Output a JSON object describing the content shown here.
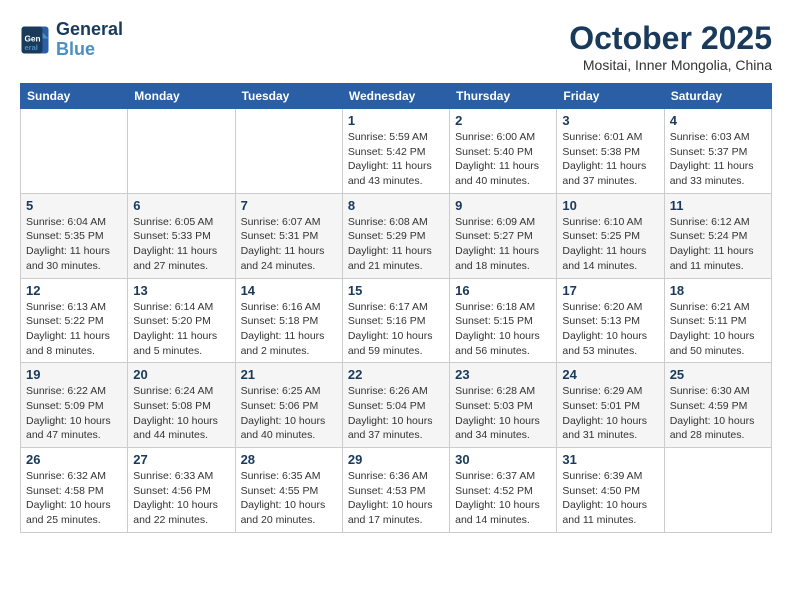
{
  "logo": {
    "line1": "General",
    "line2": "Blue"
  },
  "title": "October 2025",
  "location": "Mositai, Inner Mongolia, China",
  "days_header": [
    "Sunday",
    "Monday",
    "Tuesday",
    "Wednesday",
    "Thursday",
    "Friday",
    "Saturday"
  ],
  "weeks": [
    [
      {
        "day": "",
        "info": ""
      },
      {
        "day": "",
        "info": ""
      },
      {
        "day": "",
        "info": ""
      },
      {
        "day": "1",
        "info": "Sunrise: 5:59 AM\nSunset: 5:42 PM\nDaylight: 11 hours\nand 43 minutes."
      },
      {
        "day": "2",
        "info": "Sunrise: 6:00 AM\nSunset: 5:40 PM\nDaylight: 11 hours\nand 40 minutes."
      },
      {
        "day": "3",
        "info": "Sunrise: 6:01 AM\nSunset: 5:38 PM\nDaylight: 11 hours\nand 37 minutes."
      },
      {
        "day": "4",
        "info": "Sunrise: 6:03 AM\nSunset: 5:37 PM\nDaylight: 11 hours\nand 33 minutes."
      }
    ],
    [
      {
        "day": "5",
        "info": "Sunrise: 6:04 AM\nSunset: 5:35 PM\nDaylight: 11 hours\nand 30 minutes."
      },
      {
        "day": "6",
        "info": "Sunrise: 6:05 AM\nSunset: 5:33 PM\nDaylight: 11 hours\nand 27 minutes."
      },
      {
        "day": "7",
        "info": "Sunrise: 6:07 AM\nSunset: 5:31 PM\nDaylight: 11 hours\nand 24 minutes."
      },
      {
        "day": "8",
        "info": "Sunrise: 6:08 AM\nSunset: 5:29 PM\nDaylight: 11 hours\nand 21 minutes."
      },
      {
        "day": "9",
        "info": "Sunrise: 6:09 AM\nSunset: 5:27 PM\nDaylight: 11 hours\nand 18 minutes."
      },
      {
        "day": "10",
        "info": "Sunrise: 6:10 AM\nSunset: 5:25 PM\nDaylight: 11 hours\nand 14 minutes."
      },
      {
        "day": "11",
        "info": "Sunrise: 6:12 AM\nSunset: 5:24 PM\nDaylight: 11 hours\nand 11 minutes."
      }
    ],
    [
      {
        "day": "12",
        "info": "Sunrise: 6:13 AM\nSunset: 5:22 PM\nDaylight: 11 hours\nand 8 minutes."
      },
      {
        "day": "13",
        "info": "Sunrise: 6:14 AM\nSunset: 5:20 PM\nDaylight: 11 hours\nand 5 minutes."
      },
      {
        "day": "14",
        "info": "Sunrise: 6:16 AM\nSunset: 5:18 PM\nDaylight: 11 hours\nand 2 minutes."
      },
      {
        "day": "15",
        "info": "Sunrise: 6:17 AM\nSunset: 5:16 PM\nDaylight: 10 hours\nand 59 minutes."
      },
      {
        "day": "16",
        "info": "Sunrise: 6:18 AM\nSunset: 5:15 PM\nDaylight: 10 hours\nand 56 minutes."
      },
      {
        "day": "17",
        "info": "Sunrise: 6:20 AM\nSunset: 5:13 PM\nDaylight: 10 hours\nand 53 minutes."
      },
      {
        "day": "18",
        "info": "Sunrise: 6:21 AM\nSunset: 5:11 PM\nDaylight: 10 hours\nand 50 minutes."
      }
    ],
    [
      {
        "day": "19",
        "info": "Sunrise: 6:22 AM\nSunset: 5:09 PM\nDaylight: 10 hours\nand 47 minutes."
      },
      {
        "day": "20",
        "info": "Sunrise: 6:24 AM\nSunset: 5:08 PM\nDaylight: 10 hours\nand 44 minutes."
      },
      {
        "day": "21",
        "info": "Sunrise: 6:25 AM\nSunset: 5:06 PM\nDaylight: 10 hours\nand 40 minutes."
      },
      {
        "day": "22",
        "info": "Sunrise: 6:26 AM\nSunset: 5:04 PM\nDaylight: 10 hours\nand 37 minutes."
      },
      {
        "day": "23",
        "info": "Sunrise: 6:28 AM\nSunset: 5:03 PM\nDaylight: 10 hours\nand 34 minutes."
      },
      {
        "day": "24",
        "info": "Sunrise: 6:29 AM\nSunset: 5:01 PM\nDaylight: 10 hours\nand 31 minutes."
      },
      {
        "day": "25",
        "info": "Sunrise: 6:30 AM\nSunset: 4:59 PM\nDaylight: 10 hours\nand 28 minutes."
      }
    ],
    [
      {
        "day": "26",
        "info": "Sunrise: 6:32 AM\nSunset: 4:58 PM\nDaylight: 10 hours\nand 25 minutes."
      },
      {
        "day": "27",
        "info": "Sunrise: 6:33 AM\nSunset: 4:56 PM\nDaylight: 10 hours\nand 22 minutes."
      },
      {
        "day": "28",
        "info": "Sunrise: 6:35 AM\nSunset: 4:55 PM\nDaylight: 10 hours\nand 20 minutes."
      },
      {
        "day": "29",
        "info": "Sunrise: 6:36 AM\nSunset: 4:53 PM\nDaylight: 10 hours\nand 17 minutes."
      },
      {
        "day": "30",
        "info": "Sunrise: 6:37 AM\nSunset: 4:52 PM\nDaylight: 10 hours\nand 14 minutes."
      },
      {
        "day": "31",
        "info": "Sunrise: 6:39 AM\nSunset: 4:50 PM\nDaylight: 10 hours\nand 11 minutes."
      },
      {
        "day": "",
        "info": ""
      }
    ]
  ]
}
